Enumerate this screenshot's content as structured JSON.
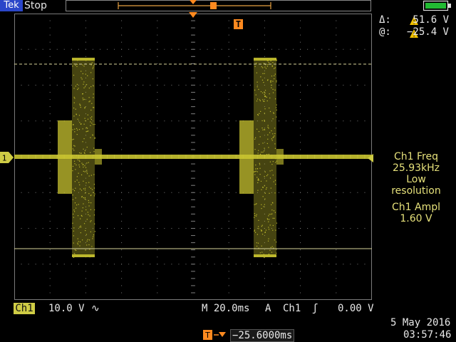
{
  "header": {
    "brand": "Tek",
    "run_state": "Stop",
    "battery_icon": "battery-icon"
  },
  "cursor_readout": {
    "delta_label": "Δ:",
    "delta_value": "51.6 V",
    "at_label": "@:",
    "at_value": "−25.4 V"
  },
  "measurements": {
    "freq_title": "Ch1 Freq",
    "freq_value": "25.93kHz",
    "freq_note_1": "Low",
    "freq_note_2": "resolution",
    "ampl_title": "Ch1 Ampl",
    "ampl_value": "1.60 V"
  },
  "status_bar": {
    "channel": "Ch1",
    "volts_div": "10.0 V",
    "coupling_symbol": "∿",
    "timebase": "M 20.0ms",
    "trigger_mode": "A",
    "trigger_source": "Ch1",
    "trigger_slope_symbol": "ʃ",
    "trigger_level": "0.00 V"
  },
  "trigger_offset": {
    "icon": "trigger-position-icon",
    "value": "−25.6000ms"
  },
  "datetime": {
    "date": "5 May 2016",
    "time": "03:57:46"
  },
  "markers": {
    "channel_marker": "1",
    "trigger_marker": "T"
  },
  "colors": {
    "trace": "#c9c430",
    "trigger": "#ff8a1f",
    "brand_bg": "#2b46c9",
    "graticule": "#7a7a7a"
  }
}
